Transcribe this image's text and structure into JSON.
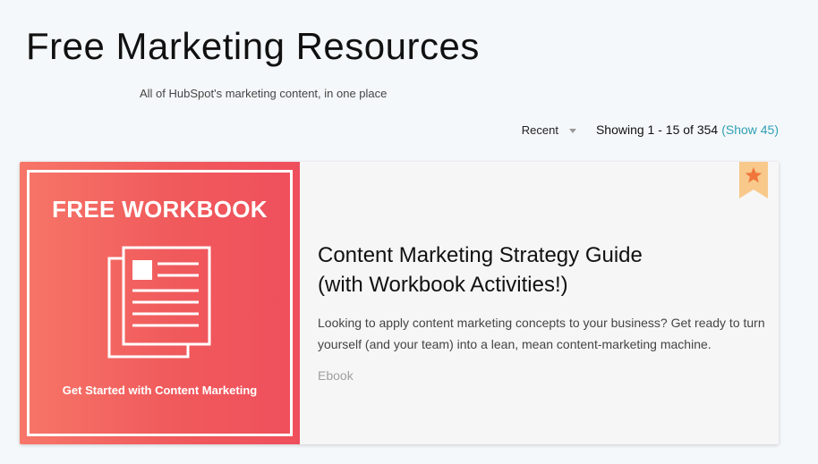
{
  "header": {
    "title": "Free Marketing Resources",
    "subtitle": "All of HubSpot's marketing content, in one place"
  },
  "toolbar": {
    "sort_label": "Recent",
    "showing_text": "Showing 1 - 15 of 354",
    "show_more": "(Show 45)"
  },
  "card": {
    "thumb_heading": "FREE WORKBOOK",
    "thumb_caption": "Get Started with Content Marketing",
    "title_line1": "Content Marketing Strategy Guide",
    "title_line2": "(with Workbook Activities!)",
    "description": "Looking to apply content marketing concepts to your business? Get ready to turn yourself (and your team) into a lean, mean content-marketing machine.",
    "type": "Ebook",
    "badge_icon": "star-ribbon-icon",
    "thumb_icon": "document-icon"
  },
  "colors": {
    "accent_link": "#2f9fb5",
    "thumb_red": "#f05a5c",
    "ribbon": "#f8c98a",
    "star": "#f0763c"
  }
}
